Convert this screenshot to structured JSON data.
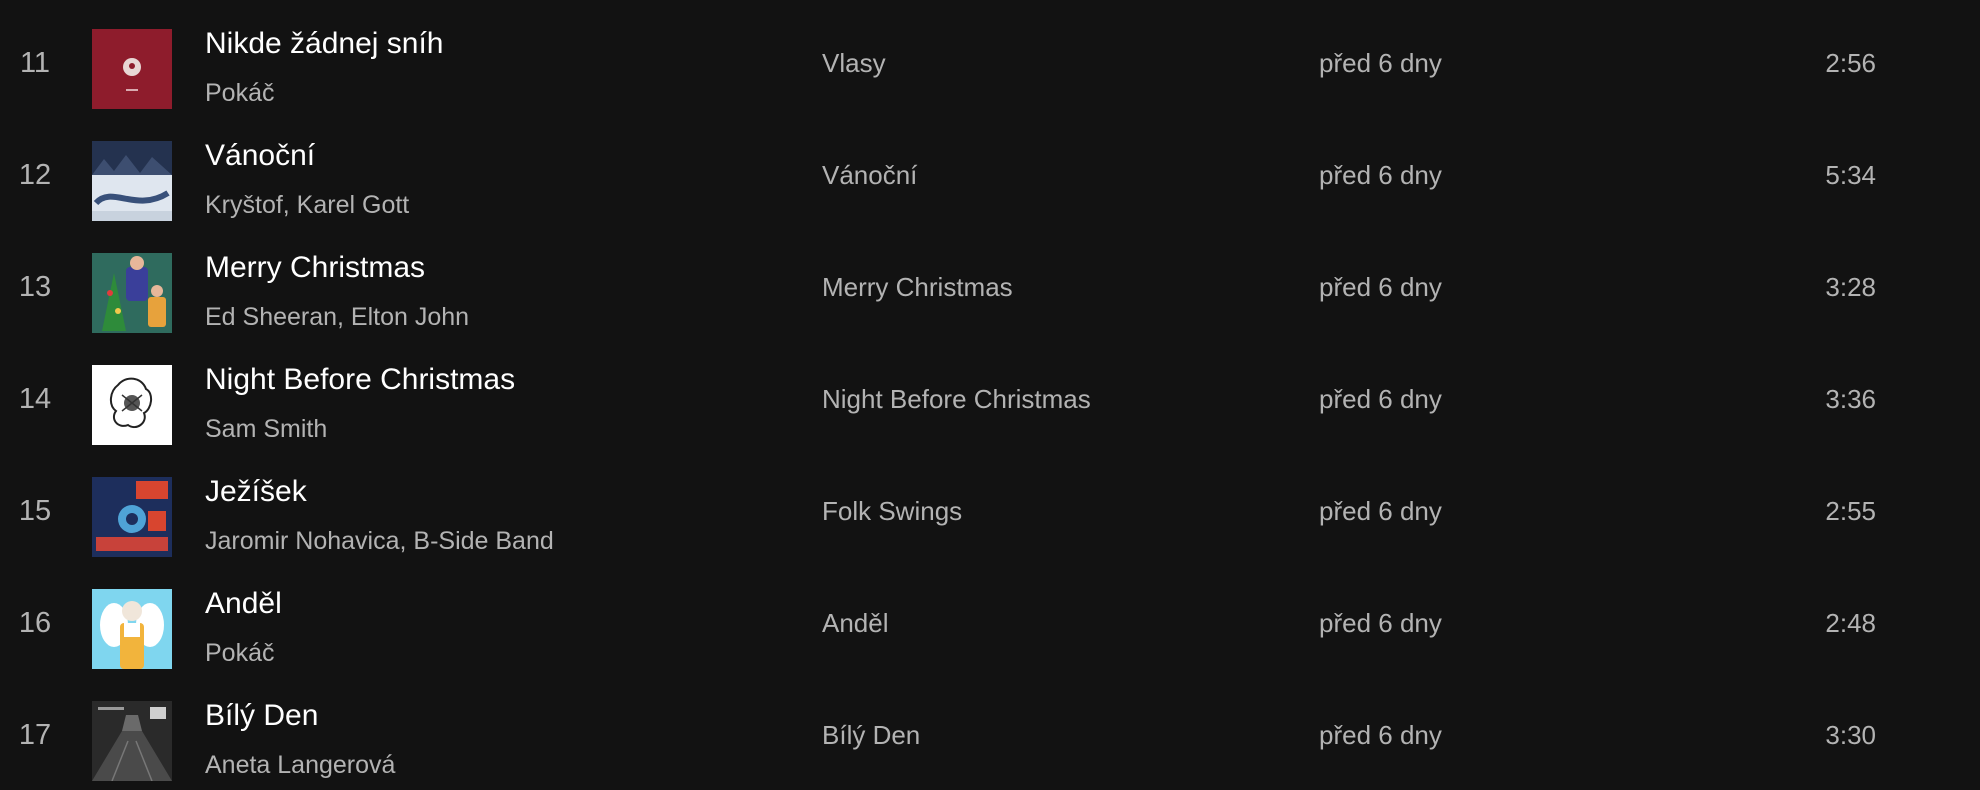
{
  "tracks": [
    {
      "number": "11",
      "title": "Nikde žádnej sníh",
      "artist": "Pokáč",
      "album": "Vlasy",
      "added": "před 6 dny",
      "duration": "2:56"
    },
    {
      "number": "12",
      "title": "Vánoční",
      "artist": "Kryštof, Karel Gott",
      "album": "Vánoční",
      "added": "před 6 dny",
      "duration": "5:34"
    },
    {
      "number": "13",
      "title": "Merry Christmas",
      "artist": "Ed Sheeran, Elton John",
      "album": "Merry Christmas",
      "added": "před 6 dny",
      "duration": "3:28"
    },
    {
      "number": "14",
      "title": "Night Before Christmas",
      "artist": "Sam Smith",
      "album": "Night Before Christmas",
      "added": "před 6 dny",
      "duration": "3:36"
    },
    {
      "number": "15",
      "title": "Ježíšek",
      "artist": "Jaromir Nohavica, B-Side Band",
      "album": "Folk Swings",
      "added": "před 6 dny",
      "duration": "2:55"
    },
    {
      "number": "16",
      "title": "Anděl",
      "artist": "Pokáč",
      "album": "Anděl",
      "added": "před 6 dny",
      "duration": "2:48"
    },
    {
      "number": "17",
      "title": "Bílý Den",
      "artist": "Aneta Langerová",
      "album": "Bílý Den",
      "added": "před 6 dny",
      "duration": "3:30"
    }
  ],
  "colors": {
    "background": "#121212",
    "primary_text": "#ffffff",
    "secondary_text": "#b3b3b3"
  }
}
